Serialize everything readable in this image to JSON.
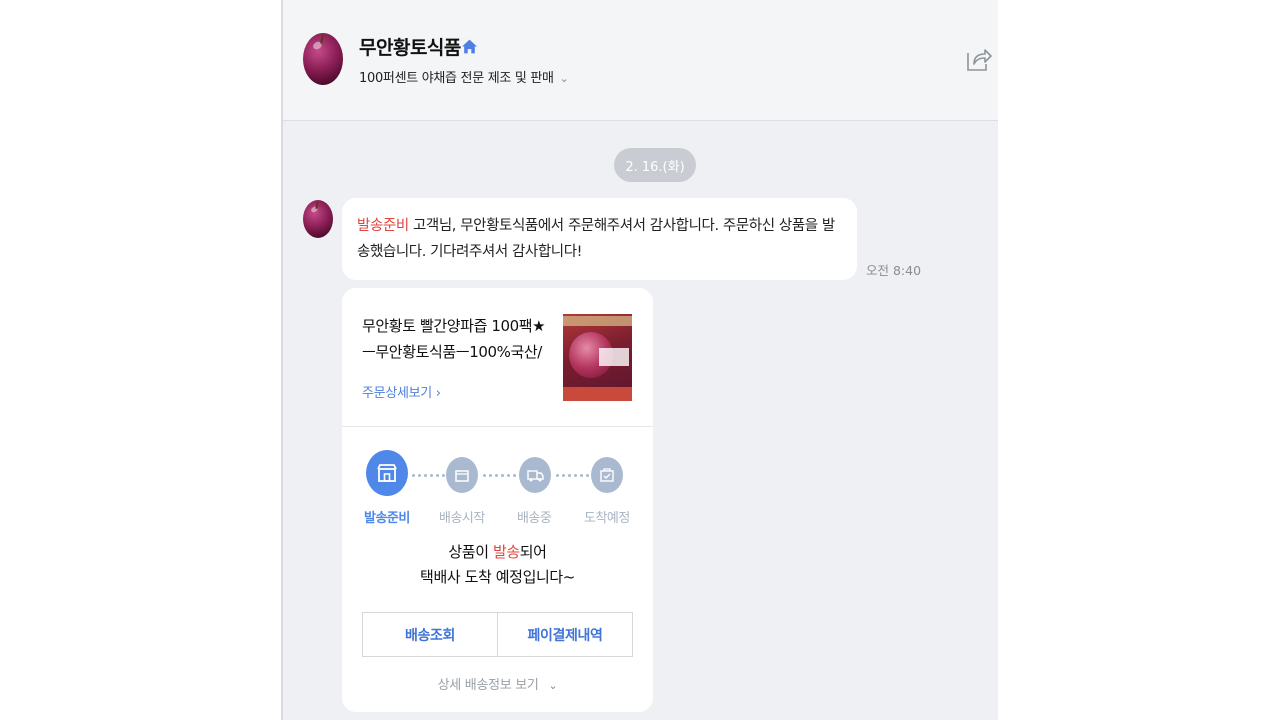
{
  "header": {
    "store_name": "무안황토식품",
    "description": "100퍼센트 야채즙 전문 제조 및 판매",
    "home_icon": "home-icon",
    "share_icon": "share-icon"
  },
  "conversation": {
    "date": "2. 16.(화)",
    "message": {
      "status": "발송준비",
      "text": " 고객님, 무안황토식품에서 주문해주셔서 감사합니다. 주문하신 상품을 발송했습니다. 기다려주셔서 감사합니다!",
      "time": "오전 8:40"
    }
  },
  "order_card": {
    "product_title": "무안황토 빨간양파즙 100팩★ ㅡ무안황토식품ㅡ100%국산/",
    "detail_link": "주문상세보기 ›",
    "steps": [
      {
        "label": "발송준비",
        "icon": "store-icon",
        "active": true
      },
      {
        "label": "배송시작",
        "icon": "box-icon",
        "active": false
      },
      {
        "label": "배송중",
        "icon": "truck-icon",
        "active": false
      },
      {
        "label": "도착예정",
        "icon": "bag-check-icon",
        "active": false
      }
    ],
    "notice_line1_pre": "상품이 ",
    "notice_line1_red": "발송",
    "notice_line1_post": "되어",
    "notice_line2": "택배사 도착 예정입니다~",
    "buttons": {
      "tracking": "배송조회",
      "payment_history": "페이결제내역"
    },
    "more_info": "상세 배송정보 보기",
    "colors": {
      "accent": "#4f88e8",
      "alert_red": "#e2463f",
      "inactive": "#a9bad0"
    }
  }
}
